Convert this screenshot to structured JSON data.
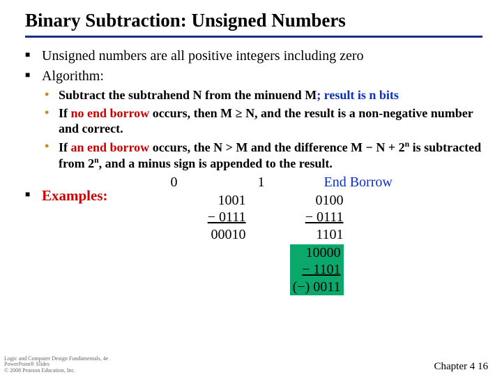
{
  "title": "Binary Subtraction: Unsigned Numbers",
  "p1": "Unsigned numbers are all positive integers including zero",
  "p2": "Algorithm:",
  "sub1_a": "Subtract the subtrahend N from the minuend M",
  "sub1_b": "; result is n bits",
  "sub2_a": "If ",
  "sub2_noend": "no end borrow",
  "sub2_b": " occurs, then M ",
  "sub2_c": " N, and the result is a non-negative number and correct.",
  "ge": "≥",
  "sub3_a": "If ",
  "sub3_end": "an end borrow",
  "sub3_b": " occurs, the N > M and the difference M ",
  "minus": "−",
  "sub3_c": " N + 2",
  "sub3_d": " is subtracted from 2",
  "sub3_e": ", and a minus sign is appended to the result.",
  "sup_n": "n",
  "examples": "Examples:",
  "endborrow": "End Borrow",
  "lbl0": "0",
  "lbl1": "1",
  "col1": {
    "r1": "1001",
    "r2": "− 0111",
    "r3": "00010"
  },
  "col2": {
    "r1": "0100",
    "r2": "− 0111",
    "r3": "1101",
    "g1": "10000",
    "g2": "− 1101",
    "g3": "(−) 0011"
  },
  "chapter": "Chapter 4    16",
  "credit1": "Logic and Computer Design Fundamentals, 4e",
  "credit2": "PowerPoint® Slides",
  "credit3": "© 2008 Pearson Education, Inc."
}
